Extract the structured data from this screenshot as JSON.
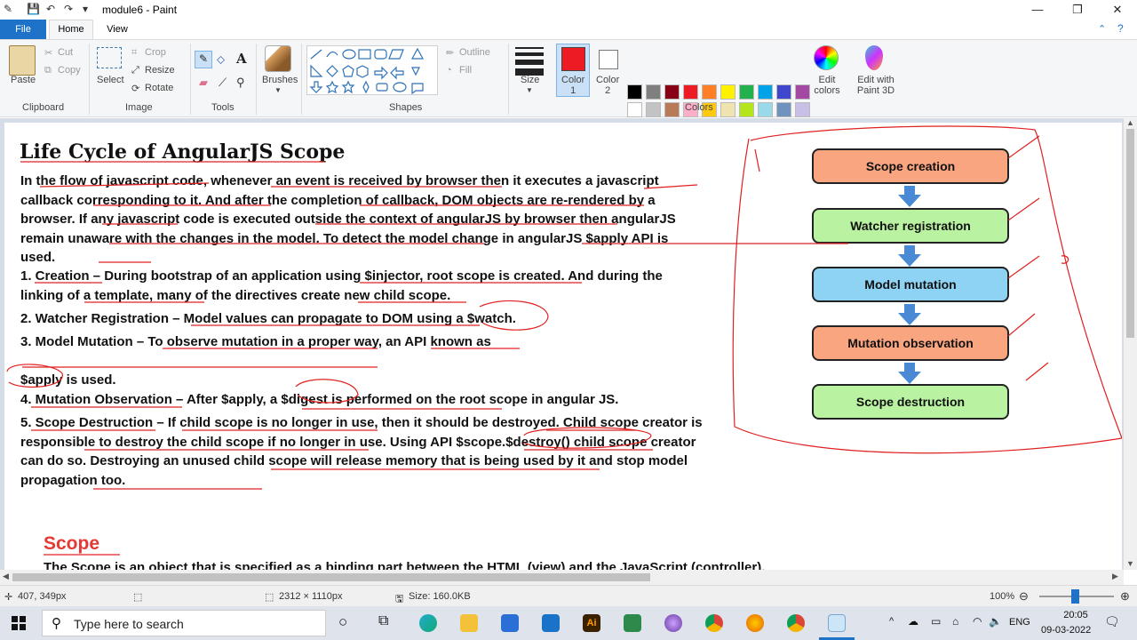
{
  "titlebar": {
    "title": "module6 - Paint"
  },
  "tabs": {
    "file": "File",
    "home": "Home",
    "view": "View"
  },
  "ribbon": {
    "clipboard": {
      "label": "Clipboard",
      "paste": "Paste",
      "cut": "Cut",
      "copy": "Copy"
    },
    "image": {
      "label": "Image",
      "select": "Select",
      "crop": "Crop",
      "resize": "Resize",
      "rotate": "Rotate"
    },
    "tools": {
      "label": "Tools"
    },
    "brushes": {
      "label": "Brushes"
    },
    "shapes": {
      "label": "Shapes",
      "outline": "Outline",
      "fill": "Fill"
    },
    "size": {
      "label": "Size"
    },
    "color1": {
      "label": "Color\n1",
      "value": "#ed1c24"
    },
    "color2": {
      "label": "Color\n2"
    },
    "colors": {
      "label": "Colors",
      "edit": "Edit colors",
      "paint3d": "Edit with Paint 3D"
    },
    "palette": [
      "#000000",
      "#7f7f7f",
      "#880015",
      "#ed1c24",
      "#ff7f27",
      "#fff200",
      "#22b14c",
      "#00a2e8",
      "#3f48cc",
      "#a349a4",
      "#ffffff",
      "#c3c3c3",
      "#b97a57",
      "#ffaec9",
      "#ffc90e",
      "#efe4b0",
      "#b5e61d",
      "#99d9ea",
      "#7092be",
      "#c8bfe7"
    ]
  },
  "document": {
    "heading": "Life Cycle of AngularJS Scope",
    "intro": "In the flow of javascript code, whenever an event is received by browser then it executes a javascript callback corresponding to it. And after the completion of callback, DOM objects are re-rendered by a browser. If any javascript code is executed outside the context of angularJS by browser then angularJS remain unaware with the changes in the model. To detect the model change in angularJS $apply API is used.",
    "item1": "1. Creation – During bootstrap of an application using $injector, root scope is created. And during the linking of a template, many of the directives create new child scope.",
    "item2": "2. Watcher Registration – Model values can propagate to DOM using a $watch.",
    "item3": "3. Model Mutation – To observe mutation in a proper way, an API known as",
    "item3b": "$apply is used.",
    "item4": "4. Mutation Observation – After $apply, a $digest is performed on the root scope in angular JS.",
    "item5": "5. Scope Destruction – If child scope is no longer in use, then it should be destroyed. Child scope creator is responsible to destroy the child scope if no longer in use. Using API $scope.$destroy() child scope creator can do so. Destroying an unused child scope will release memory that is being used by it and stop model propagation too.",
    "scope_heading": "Scope",
    "scope_desc": "The Scope is an object that is specified as a binding part between the HTML (view) and the JavaScript (controller)."
  },
  "flow": [
    {
      "label": "Scope creation",
      "color": "#f9a580"
    },
    {
      "label": "Watcher registration",
      "color": "#b9f2a1"
    },
    {
      "label": "Model mutation",
      "color": "#8fd3f4"
    },
    {
      "label": "Mutation observation",
      "color": "#f9a580"
    },
    {
      "label": "Scope destruction",
      "color": "#b9f2a1"
    }
  ],
  "status": {
    "cursor": "407, 349px",
    "dimensions": "2312 × 1110px",
    "size": "Size: 160.0KB",
    "zoom": "100%"
  },
  "taskbar": {
    "search_placeholder": "Type here to search",
    "lang": "ENG",
    "time": "20:05",
    "date": "09-03-2022"
  }
}
